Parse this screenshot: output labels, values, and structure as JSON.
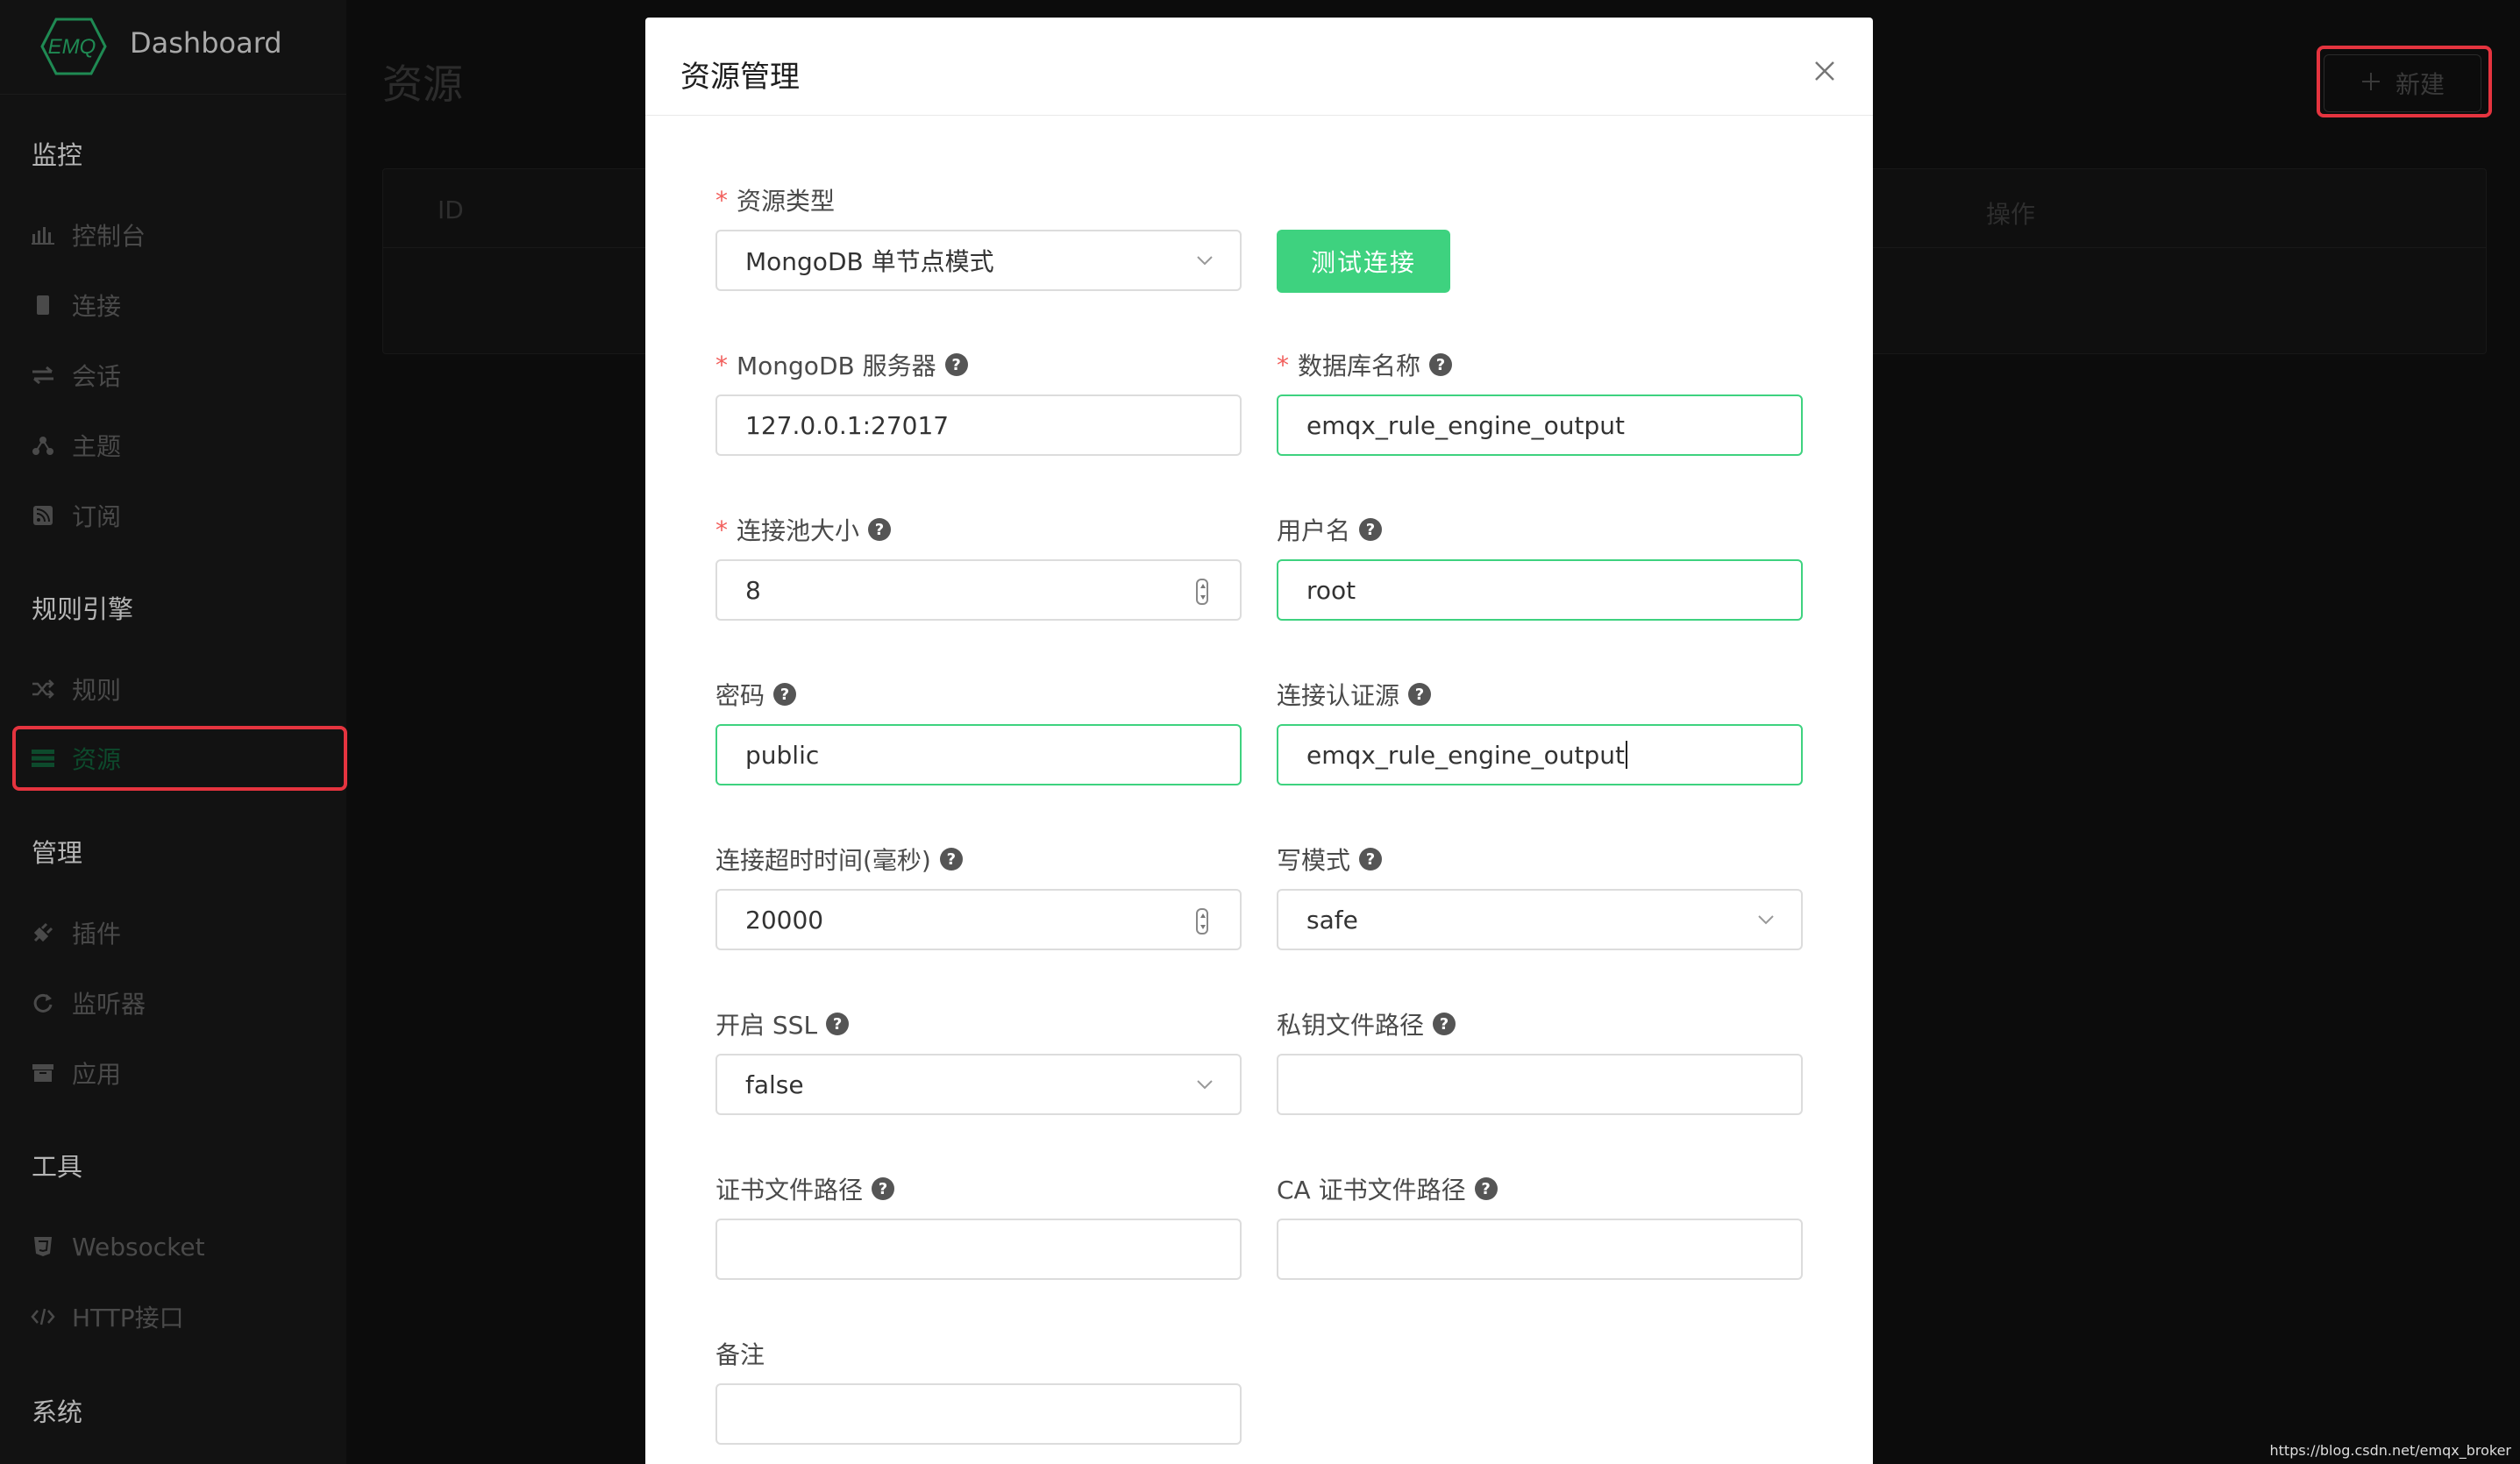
{
  "app": {
    "brand_logo_text": "EMQ",
    "brand_title": "Dashboard"
  },
  "sidebar": {
    "groups": [
      {
        "label": "监控"
      },
      {
        "label": "规则引擎"
      },
      {
        "label": "管理"
      },
      {
        "label": "工具"
      },
      {
        "label": "系统"
      }
    ],
    "items": [
      {
        "label": "控制台",
        "icon": "bar-chart-icon"
      },
      {
        "label": "连接",
        "icon": "device-icon"
      },
      {
        "label": "会话",
        "icon": "swap-icon"
      },
      {
        "label": "主题",
        "icon": "topic-icon"
      },
      {
        "label": "订阅",
        "icon": "rss-icon"
      },
      {
        "label": "规则",
        "icon": "shuffle-icon"
      },
      {
        "label": "资源",
        "icon": "server-icon",
        "active": true
      },
      {
        "label": "插件",
        "icon": "plug-icon"
      },
      {
        "label": "监听器",
        "icon": "refresh-icon"
      },
      {
        "label": "应用",
        "icon": "archive-icon"
      },
      {
        "label": "Websocket",
        "icon": "html5-icon"
      },
      {
        "label": "HTTP接口",
        "icon": "code-icon"
      }
    ]
  },
  "page": {
    "title": "资源",
    "new_button": "新建",
    "table": {
      "columns": [
        "ID",
        "操作"
      ]
    }
  },
  "modal": {
    "title": "资源管理",
    "test_button": "测试连接",
    "fields": {
      "resource_type": {
        "label": "资源类型",
        "required": true,
        "value": "MongoDB 单节点模式"
      },
      "server": {
        "label": "MongoDB 服务器",
        "required": true,
        "value": "127.0.0.1:27017"
      },
      "database": {
        "label": "数据库名称",
        "required": true,
        "value": "emqx_rule_engine_output"
      },
      "pool_size": {
        "label": "连接池大小",
        "required": true,
        "value": "8"
      },
      "username": {
        "label": "用户名",
        "value": "root"
      },
      "password": {
        "label": "密码",
        "value": "public"
      },
      "auth_source": {
        "label": "连接认证源",
        "value": "emqx_rule_engine_output"
      },
      "timeout": {
        "label": "连接超时时间(毫秒)",
        "value": "20000"
      },
      "write_mode": {
        "label": "写模式",
        "value": "safe"
      },
      "ssl": {
        "label": "开启 SSL",
        "value": "false"
      },
      "keyfile": {
        "label": "私钥文件路径",
        "value": ""
      },
      "certfile": {
        "label": "证书文件路径",
        "value": ""
      },
      "cacertfile": {
        "label": "CA 证书文件路径",
        "value": ""
      },
      "description": {
        "label": "备注",
        "value": ""
      }
    }
  },
  "colors": {
    "accent": "#3ed27f",
    "highlight": "#e5343f",
    "required": "#f25f5c"
  },
  "watermark": "https://blog.csdn.net/emqx_broker"
}
